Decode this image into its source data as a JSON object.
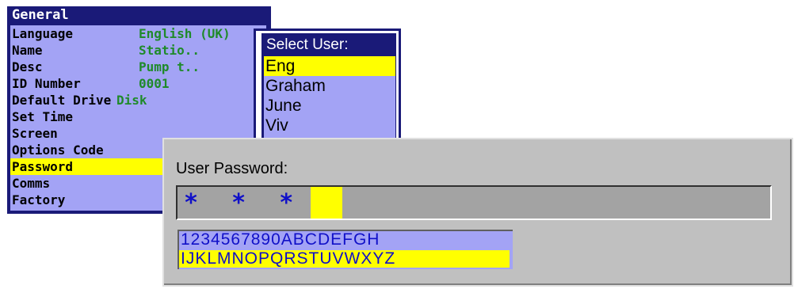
{
  "general_menu": {
    "title": "General",
    "items": [
      {
        "label": "Language",
        "value": "English (UK)",
        "selected": false
      },
      {
        "label": "Name",
        "value": "Statio..",
        "selected": false
      },
      {
        "label": "Desc",
        "value": "Pump t..",
        "selected": false
      },
      {
        "label": "ID Number",
        "value": "0001",
        "selected": false
      },
      {
        "label": "Default Drive",
        "value": "Disk",
        "selected": false
      },
      {
        "label": "Set Time",
        "value": "",
        "selected": false
      },
      {
        "label": "Screen",
        "value": "",
        "selected": false
      },
      {
        "label": "Options Code",
        "value": "",
        "selected": false
      },
      {
        "label": "Password",
        "value": "",
        "selected": true
      },
      {
        "label": "Comms",
        "value": "",
        "selected": false
      },
      {
        "label": "Factory",
        "value": "",
        "selected": false
      }
    ]
  },
  "select_user": {
    "title": "Select User:",
    "users": [
      {
        "name": "Eng",
        "selected": true
      },
      {
        "name": "Graham",
        "selected": false
      },
      {
        "name": "June",
        "selected": false
      },
      {
        "name": "Viv",
        "selected": false
      }
    ]
  },
  "password_dialog": {
    "title": "User Password:",
    "masked_value": "****",
    "char_rows": [
      "1234567890ABCDEFGH",
      "IJKLMNOPQRSTUVWXYZ"
    ]
  },
  "colors": {
    "panel_dark": "#1a1a78",
    "panel_light": "#a3a3f5",
    "highlight": "#ffff00",
    "value_green": "#1f8a2a",
    "dialog_gray": "#c0c0c0",
    "char_blue": "#1010c8"
  }
}
